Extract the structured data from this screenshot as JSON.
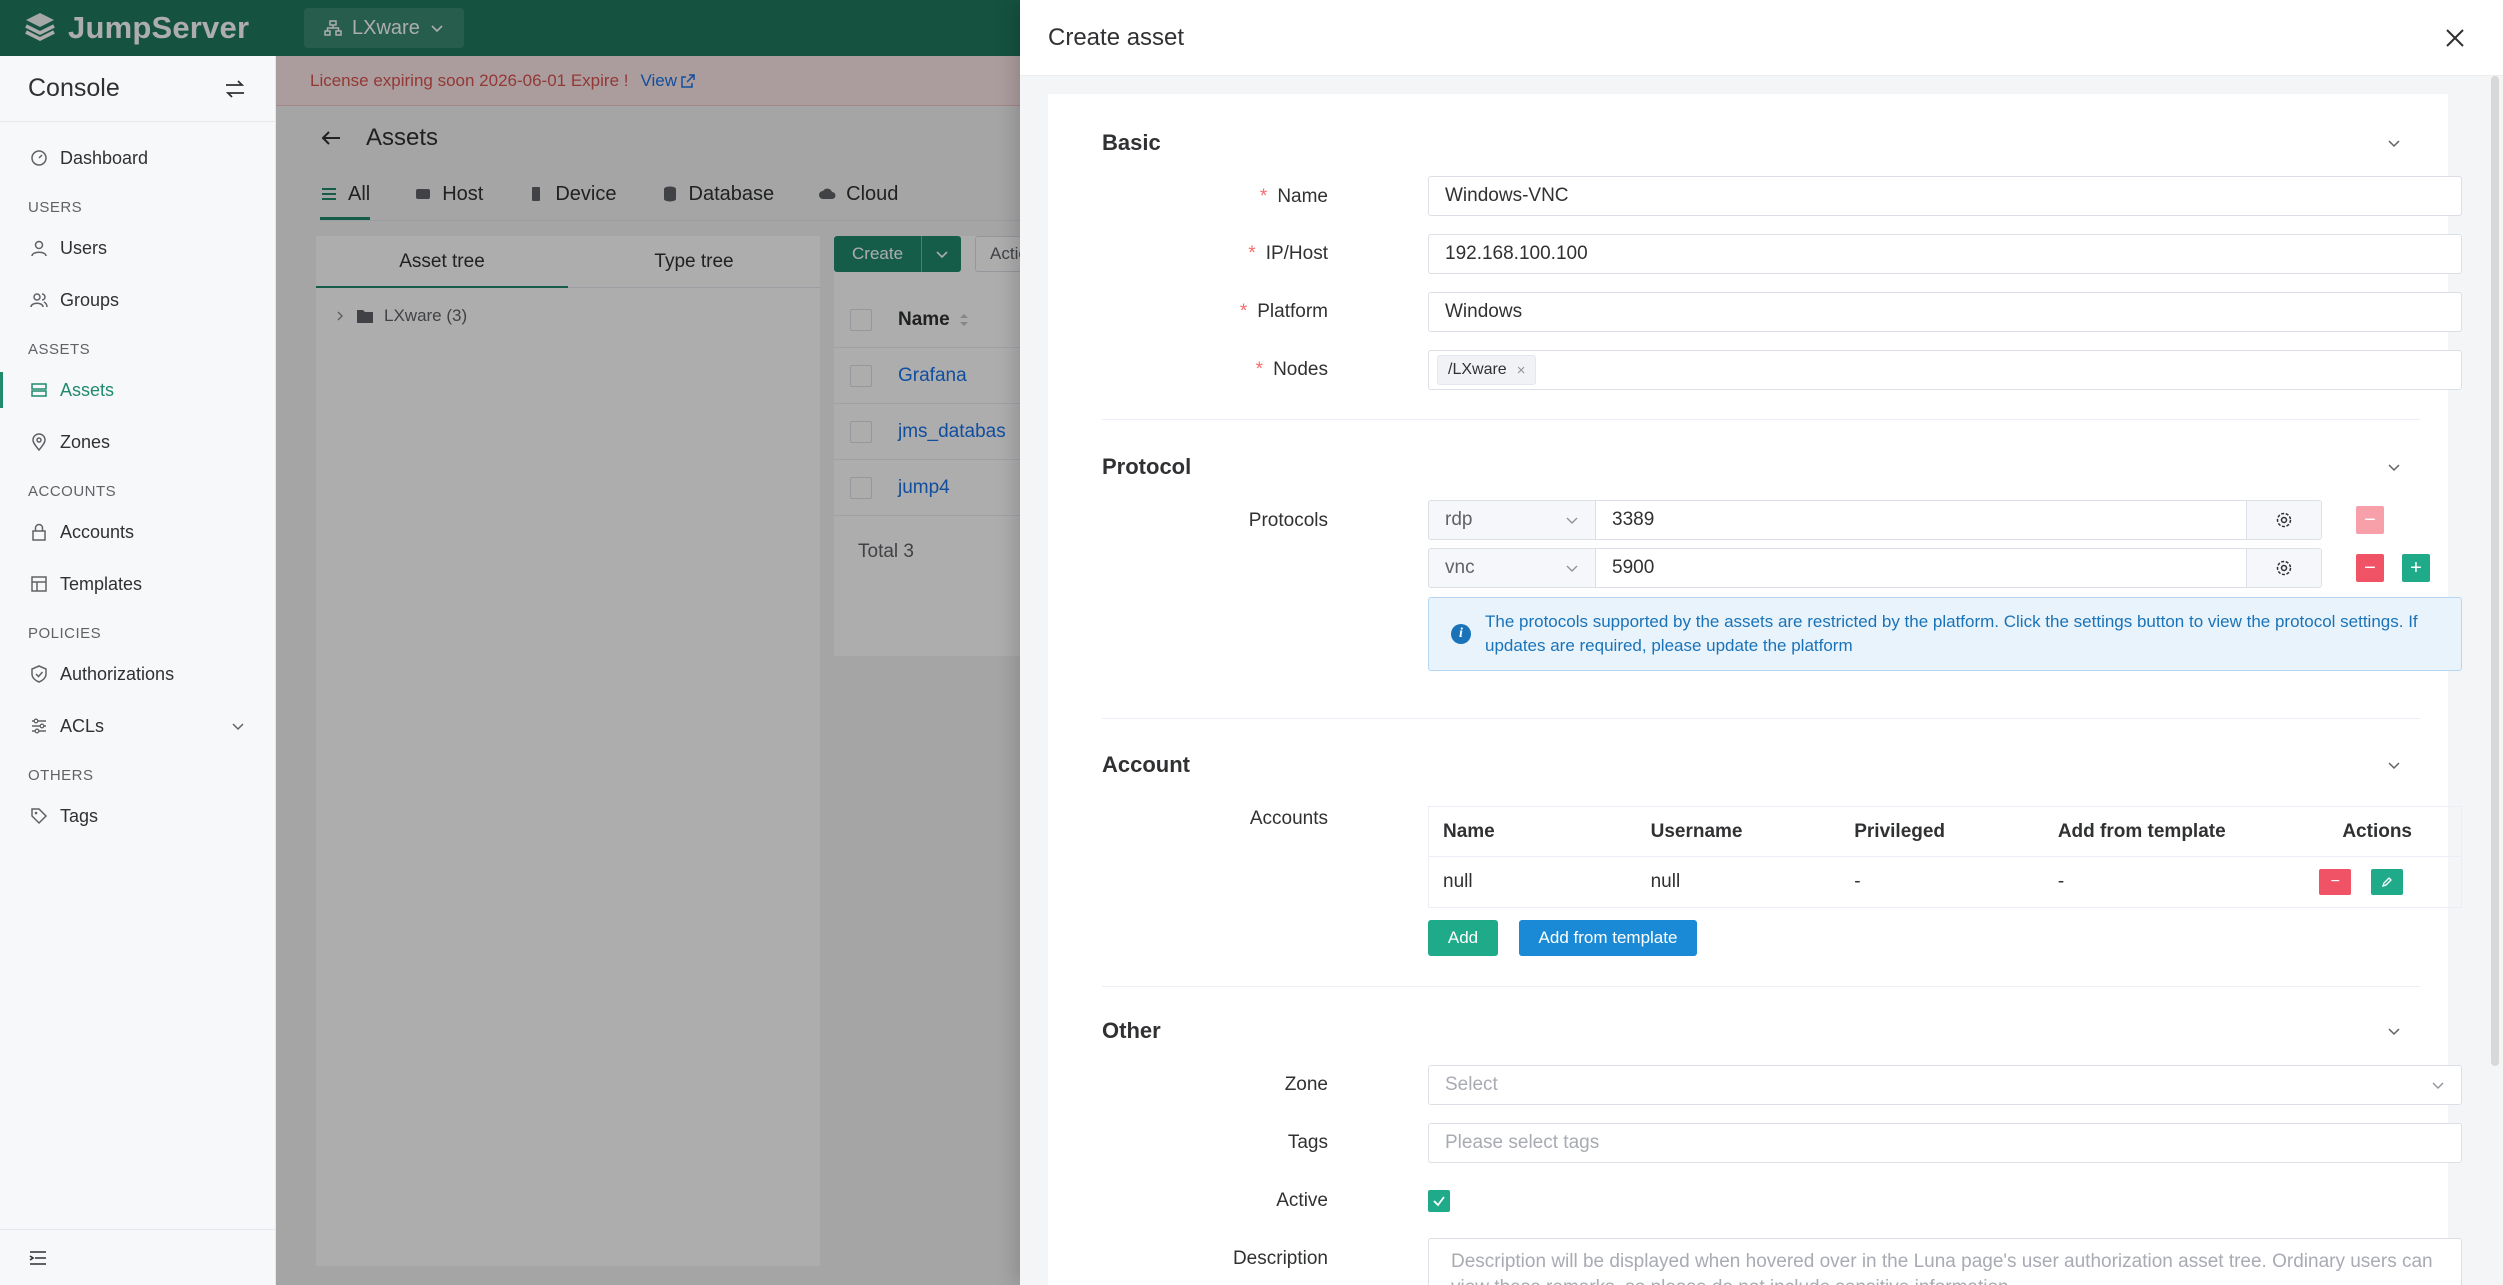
{
  "app": {
    "brand": "JumpServer",
    "org": "LXware"
  },
  "sidebar": {
    "title": "Console",
    "sections": {
      "users": "USERS",
      "assets": "ASSETS",
      "accounts": "ACCOUNTS",
      "policies": "POLICIES",
      "others": "OTHERS"
    },
    "items": {
      "dashboard": "Dashboard",
      "users": "Users",
      "groups": "Groups",
      "assets": "Assets",
      "zones": "Zones",
      "accounts": "Accounts",
      "templates": "Templates",
      "authorizations": "Authorizations",
      "acls": "ACLs",
      "tags": "Tags"
    }
  },
  "banner": {
    "text": "License expiring soon 2026-06-01 Expire !",
    "link": "View"
  },
  "page": {
    "title": "Assets",
    "tabs": [
      "All",
      "Host",
      "Device",
      "Database",
      "Cloud"
    ]
  },
  "tree": {
    "tabs": [
      "Asset tree",
      "Type tree"
    ],
    "root": "LXware (3)"
  },
  "list": {
    "create": "Create",
    "actions": "Actio",
    "header_name": "Name",
    "rows": [
      "Grafana",
      "jms_databas",
      "jump4"
    ],
    "total": "Total 3"
  },
  "drawer": {
    "title": "Create asset",
    "basic": {
      "title": "Basic",
      "name_label": "Name",
      "name_value": "Windows-VNC",
      "host_label": "IP/Host",
      "host_value": "192.168.100.100",
      "platform_label": "Platform",
      "platform_value": "Windows",
      "nodes_label": "Nodes",
      "nodes_value": "/LXware",
      "remove_chip": "×"
    },
    "protocol": {
      "title": "Protocol",
      "label": "Protocols",
      "rows": [
        {
          "name": "rdp",
          "port": "3389"
        },
        {
          "name": "vnc",
          "port": "5900"
        }
      ],
      "info": "The protocols supported by the assets are restricted by the platform. Click the settings button to view the protocol settings. If updates are required, please update the platform"
    },
    "account": {
      "title": "Account",
      "label": "Accounts",
      "columns": [
        "Name",
        "Username",
        "Privileged",
        "Add from template",
        "Actions"
      ],
      "row": [
        "null",
        "null",
        "-",
        "-"
      ],
      "add": "Add",
      "add_template": "Add from template"
    },
    "other": {
      "title": "Other",
      "zone_label": "Zone",
      "zone_placeholder": "Select",
      "tags_label": "Tags",
      "tags_placeholder": "Please select tags",
      "active_label": "Active",
      "description_label": "Description",
      "description_placeholder": "Description will be displayed when hovered over in the Luna page's user authorization asset tree. Ordinary users can view these remarks, so please do not include sensitive information."
    }
  },
  "colors": {
    "brand": "#1f7a5f",
    "primary": "#1f8a6c",
    "danger": "#f05365",
    "info": "#1a73b8"
  }
}
